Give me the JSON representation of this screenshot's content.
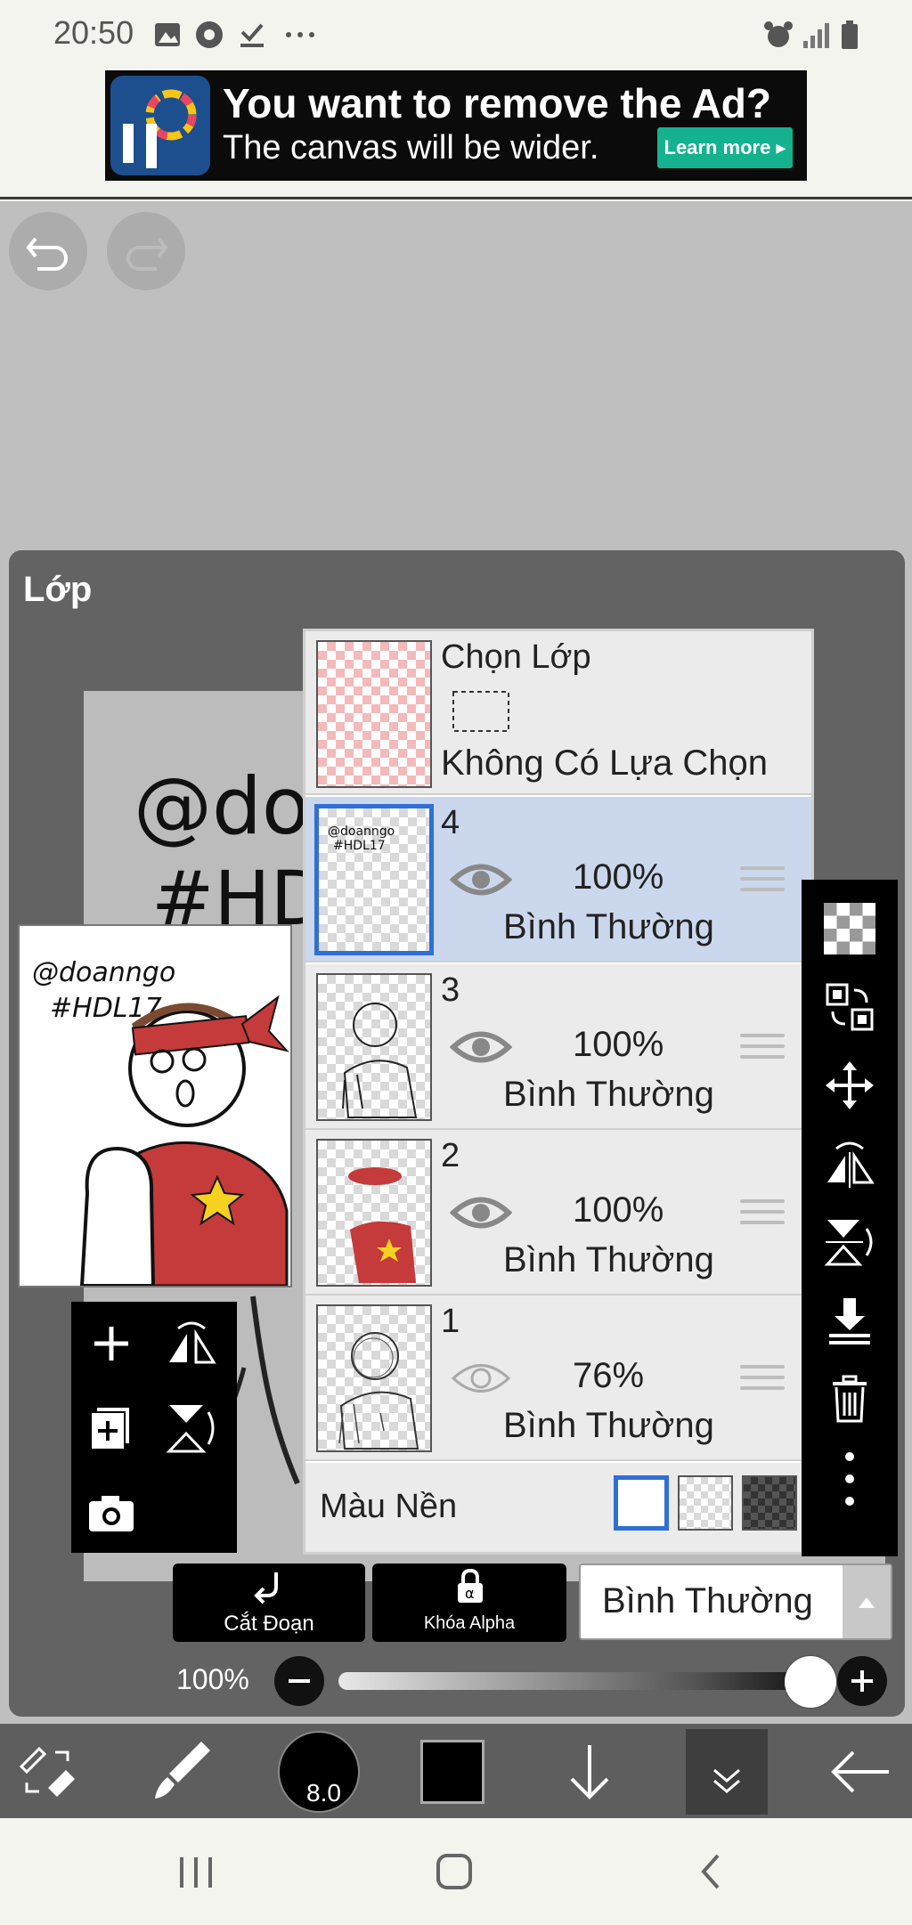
{
  "status_bar": {
    "time": "20:50",
    "left_icons": [
      "image-icon",
      "chrome-icon",
      "download-done-icon",
      "more-icon"
    ],
    "right_icons": [
      "alarm-icon",
      "signal-icon",
      "battery-icon"
    ]
  },
  "ad": {
    "headline": "You want to remove the Ad?",
    "subline": "The canvas will be wider.",
    "cta": "Learn more ▸",
    "logo_text": "iP"
  },
  "panel": {
    "title": "Lớp"
  },
  "selection_layer": {
    "name": "Chọn Lớp",
    "status": "Không Có Lựa Chọn"
  },
  "layers": [
    {
      "name": "4",
      "opacity": "100%",
      "blend": "Bình Thường",
      "visible": true,
      "selected": true
    },
    {
      "name": "3",
      "opacity": "100%",
      "blend": "Bình Thường",
      "visible": true,
      "selected": false
    },
    {
      "name": "2",
      "opacity": "100%",
      "blend": "Bình Thường",
      "visible": true,
      "selected": false
    },
    {
      "name": "1",
      "opacity": "76%",
      "blend": "Bình Thường",
      "visible": true,
      "selected": false
    }
  ],
  "background": {
    "label": "Màu Nền",
    "options": [
      "white",
      "transparent",
      "dark-checker"
    ],
    "selected": "white"
  },
  "artwork": {
    "signature_line1": "@doanngo",
    "signature_line2": "#HDL17",
    "canvas_text_1": "@doa",
    "canvas_text_2": "#HD"
  },
  "buttons": {
    "clipping": "Cắt Đoạn",
    "alpha_lock": "Khóa Alpha",
    "blend_mode": "Bình Thường"
  },
  "opacity_slider": {
    "label": "100%",
    "value": 1.0
  },
  "brush": {
    "size": "8.0",
    "color": "#000000"
  },
  "colors": {
    "accent": "#2f6fd6",
    "selected_row": "#cbd7ec",
    "panel": "#636363",
    "toolbar": "#5e5e5e"
  }
}
